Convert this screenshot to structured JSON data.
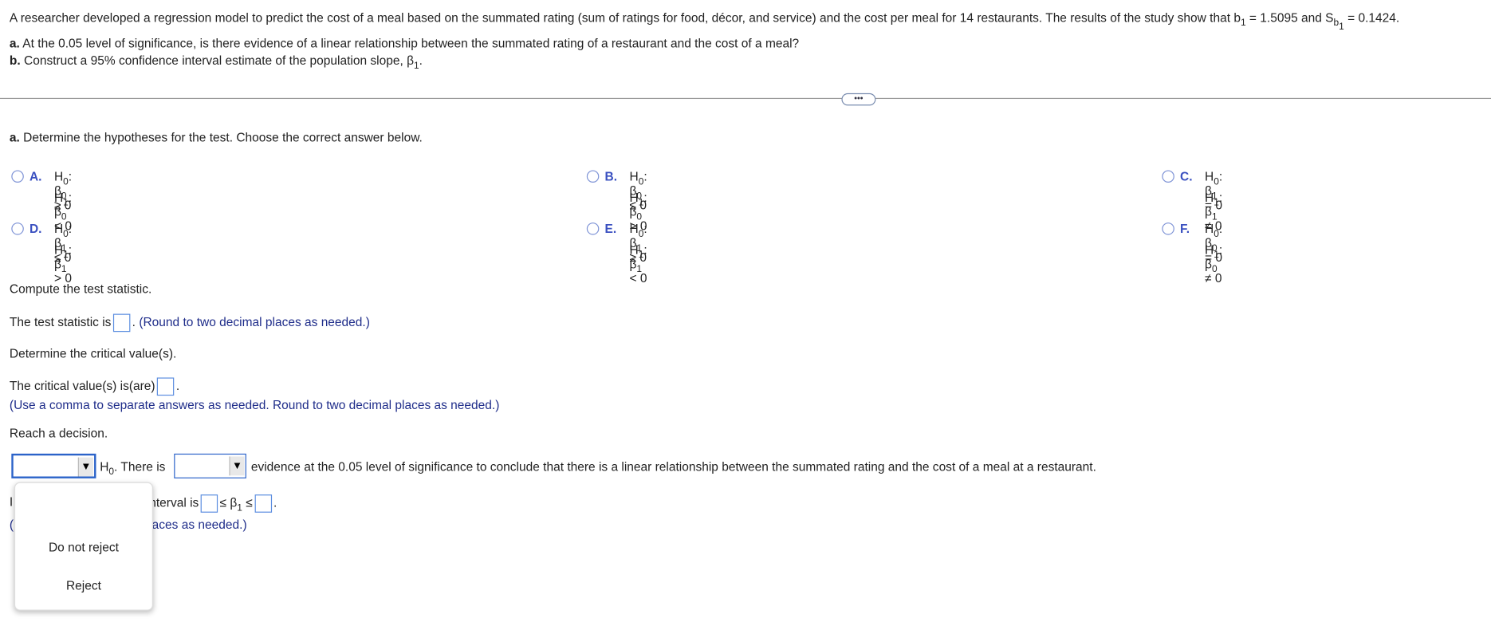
{
  "question": {
    "intro": "A researcher developed a regression model to predict the cost of a meal based on the summated rating (sum of ratings for food, décor, and service) and the cost per meal for 14 restaurants. The results of the study show that b",
    "b1_sub": "1",
    "b1_value": " = 1.5095 and S",
    "sb_sub": "b",
    "sb_sub2": "1",
    "sb_value": " = 0.1424.",
    "part_a_label": "a.",
    "part_a": " At the 0.05 level of significance, is there evidence of a linear relationship between the summated rating of a restaurant and the cost of a meal?",
    "part_b_label": "b.",
    "part_b": " Construct a 95% confidence interval estimate of the population slope, β",
    "part_b_sub": "1",
    "part_b_end": "."
  },
  "divider": {
    "more_label": "•••"
  },
  "hypotheses": {
    "prompt_label": "a.",
    "prompt": " Determine the hypotheses for the test. Choose the correct answer below.",
    "options": [
      {
        "letter": "A.",
        "h0": "β",
        "h0sub": "0",
        "h0op": " ≥ 0",
        "h1": "β",
        "h1sub": "0",
        "h1op": " < 0"
      },
      {
        "letter": "B.",
        "h0": "β",
        "h0sub": "0",
        "h0op": " ≤ 0",
        "h1": "β",
        "h1sub": "0",
        "h1op": " > 0"
      },
      {
        "letter": "C.",
        "h0": "β",
        "h0sub": "1",
        "h0op": " = 0",
        "h1": "β",
        "h1sub": "1",
        "h1op": " ≠ 0"
      },
      {
        "letter": "D.",
        "h0": "β",
        "h0sub": "1",
        "h0op": " ≤ 0",
        "h1": "β",
        "h1sub": "1",
        "h1op": " > 0"
      },
      {
        "letter": "E.",
        "h0": "β",
        "h0sub": "1",
        "h0op": " ≥ 0",
        "h1": "β",
        "h1sub": "1",
        "h1op": " < 0"
      },
      {
        "letter": "F.",
        "h0": "β",
        "h0sub": "0",
        "h0op": " = 0",
        "h1": "β",
        "h1sub": "0",
        "h1op": " ≠ 0"
      }
    ]
  },
  "test_statistic": {
    "heading": "Compute the test statistic.",
    "label": "The test statistic is",
    "value": "",
    "hint": "(Round to two decimal places as needed.)"
  },
  "critical": {
    "heading": "Determine the critical value(s).",
    "label": "The critical value(s) is(are)",
    "value": "",
    "hint": "(Use a comma to separate answers as needed. Round to two decimal places as needed.)"
  },
  "decision": {
    "heading": "Reach a decision.",
    "select1_value": "",
    "h0": "H",
    "h0sub": "0",
    "mid": ". There is",
    "select2_value": "",
    "tail": "evidence at the 0.05 level of significance to conclude that there is a linear relationship between the summated rating and the cost of a meal at a restaurant.",
    "dropdown_options": [
      "Do not reject",
      "Reject"
    ]
  },
  "interval": {
    "frag_left": "I",
    "frag_text": "nterval is",
    "beta": "≤ β",
    "beta_sub": "1",
    "le": " ≤",
    "end": ".",
    "hint_left": "(",
    "hint_frag": "laces as needed.)"
  },
  "colors": {
    "accent": "#2b63c9",
    "option_letter": "#3a50c0",
    "hint": "#1f2d8a"
  }
}
